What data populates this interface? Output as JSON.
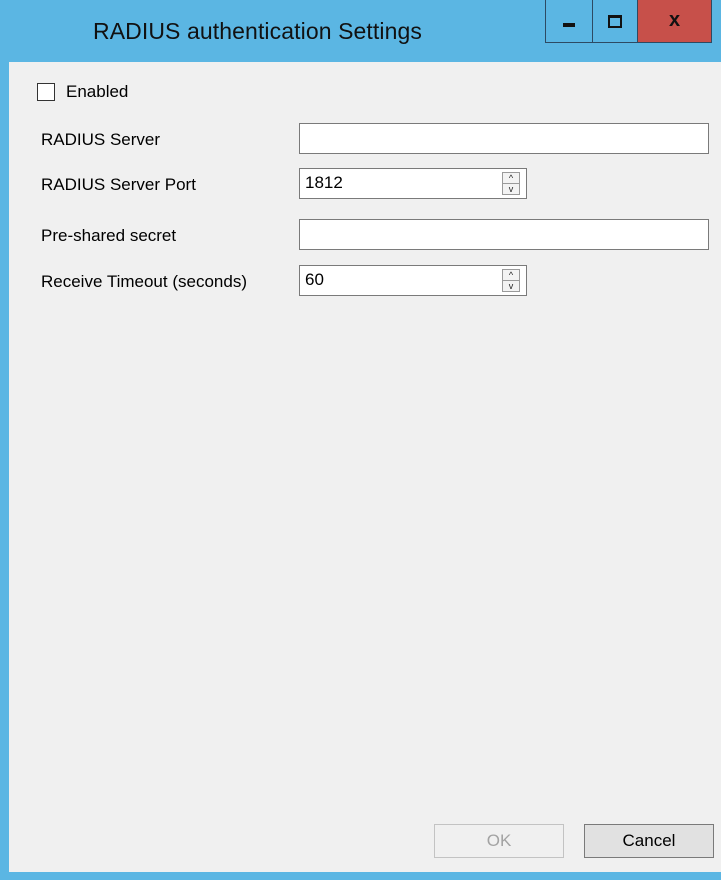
{
  "window": {
    "title": "RADIUS authentication Settings",
    "minimize_icon": "minimize-icon",
    "maximize_icon": "maximize-icon",
    "close_icon": "close-icon",
    "close_glyph": "x",
    "close_color": "#c7504a",
    "frame_color": "#5bb6e3"
  },
  "form": {
    "enabled": {
      "label": "Enabled",
      "checked": false
    },
    "radius_server": {
      "label": "RADIUS Server",
      "value": ""
    },
    "radius_server_port": {
      "label": "RADIUS Server Port",
      "value": "1812"
    },
    "pre_shared_secret": {
      "label": "Pre-shared secret",
      "value": ""
    },
    "receive_timeout": {
      "label": "Receive Timeout (seconds)",
      "value": "60"
    }
  },
  "buttons": {
    "ok": {
      "label": "OK",
      "enabled": false
    },
    "cancel": {
      "label": "Cancel",
      "enabled": true
    }
  },
  "spinner": {
    "up_glyph": "^",
    "down_glyph": "v"
  }
}
